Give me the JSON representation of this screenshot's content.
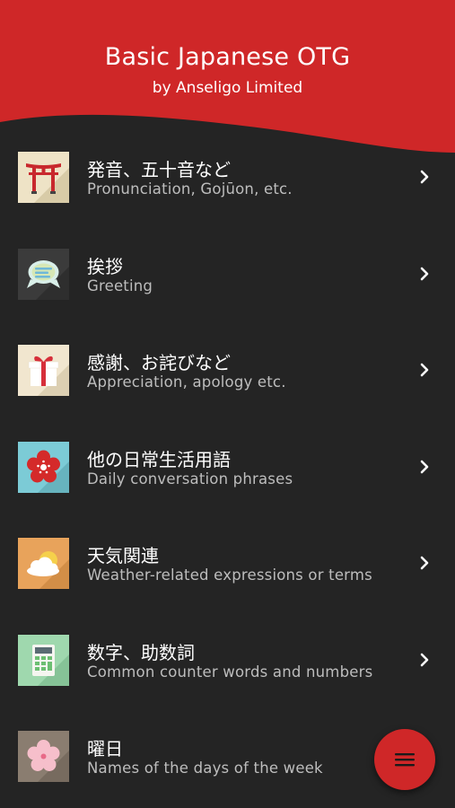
{
  "header": {
    "title": "Basic Japanese OTG",
    "subtitle": "by Anseligo Limited"
  },
  "colors": {
    "brand_red": "#cf2728",
    "background": "#242424",
    "secondary_text": "#bdbdbd"
  },
  "items": [
    {
      "jp": "発音、五十音など",
      "en": "Pronunciation, Gojūon, etc.",
      "icon": "torii-gate-icon"
    },
    {
      "jp": "挨拶",
      "en": "Greeting",
      "icon": "speech-bubbles-icon"
    },
    {
      "jp": "感謝、お詫びなど",
      "en": "Appreciation, apology etc.",
      "icon": "gift-box-icon"
    },
    {
      "jp": "他の日常生活用語",
      "en": "Daily conversation phrases",
      "icon": "plum-blossom-icon"
    },
    {
      "jp": "天気関連",
      "en": "Weather-related expressions or terms",
      "icon": "sun-cloud-icon"
    },
    {
      "jp": "数字、助数詞",
      "en": "Common counter words and numbers",
      "icon": "calculator-icon"
    },
    {
      "jp": "曜日",
      "en": "Names of the days of the week",
      "icon": "cherry-blossom-icon"
    }
  ],
  "fab": {
    "icon": "menu-icon"
  }
}
